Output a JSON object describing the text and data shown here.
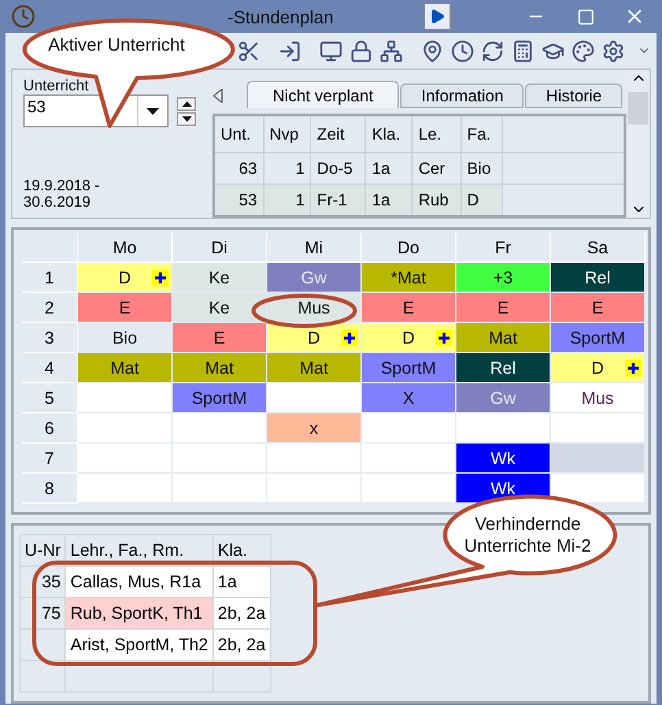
{
  "window": {
    "title": "-Stundenplan"
  },
  "lesson_panel": {
    "label": "Unterricht",
    "value": "53",
    "date_range": "19.9.2018 -\n30.6.2019"
  },
  "tabs": [
    {
      "label": "Nicht verplant",
      "selected": true
    },
    {
      "label": "Information",
      "selected": false
    },
    {
      "label": "Historie",
      "selected": false
    }
  ],
  "unplanned_table": {
    "columns": [
      "Unt.",
      "Nvp",
      "Zeit",
      "Kla.",
      "Le.",
      "Fa."
    ],
    "rows": [
      {
        "cells": [
          "63",
          "1",
          "Do-5",
          "1a",
          "Cer",
          "Bio"
        ],
        "selected": false
      },
      {
        "cells": [
          "53",
          "1",
          "Fr-1",
          "1a",
          "Rub",
          "D"
        ],
        "selected": true
      }
    ]
  },
  "timetable": {
    "days": [
      "Mo",
      "Di",
      "Mi",
      "Do",
      "Fr",
      "Sa"
    ],
    "periods": [
      {
        "label": "1",
        "cells": [
          {
            "text": "D",
            "color": "#ffff80",
            "flag": true
          },
          {
            "text": "Ke",
            "color": "#dce6e4"
          },
          {
            "text": "Gw",
            "color": "#8080c0"
          },
          {
            "text": "*Mat",
            "color": "#b8b800"
          },
          {
            "text": "+3",
            "color": "#40ff40"
          },
          {
            "text": "Rel",
            "color": "#004040"
          }
        ]
      },
      {
        "label": "2",
        "cells": [
          {
            "text": "E",
            "color": "#ff8080"
          },
          {
            "text": "Ke",
            "color": "#dce6e4"
          },
          {
            "text": "Mus",
            "color": "#dce6e4"
          },
          {
            "text": "E",
            "color": "#ff8080"
          },
          {
            "text": "E",
            "color": "#ff8080"
          },
          {
            "text": "E",
            "color": "#ff8080"
          }
        ]
      },
      {
        "label": "3",
        "cells": [
          {
            "text": "Bio",
            "color": "#e4eaf2"
          },
          {
            "text": "E",
            "color": "#ff8080"
          },
          {
            "text": "D",
            "color": "#ffff80",
            "flag": true
          },
          {
            "text": "D",
            "color": "#ffff80",
            "flag": true
          },
          {
            "text": "Mat",
            "color": "#b8b800"
          },
          {
            "text": "SportM",
            "color": "#8080ff"
          }
        ]
      },
      {
        "label": "4",
        "cells": [
          {
            "text": "Mat",
            "color": "#b8b800"
          },
          {
            "text": "Mat",
            "color": "#b8b800"
          },
          {
            "text": "Mat",
            "color": "#b8b800"
          },
          {
            "text": "SportM",
            "color": "#8080ff"
          },
          {
            "text": "Rel",
            "color": "#004040"
          },
          {
            "text": "D",
            "color": "#ffff80",
            "flag": true
          }
        ]
      },
      {
        "label": "5",
        "cells": [
          {
            "color": "#ffffff"
          },
          {
            "text": "SportM",
            "color": "#8080ff"
          },
          {
            "color": "#ffffff"
          },
          {
            "text": "X",
            "color": "#8080ff"
          },
          {
            "text": "Gw",
            "color": "#8080c0"
          },
          {
            "text": "Mus",
            "color": "#ffffff"
          }
        ]
      },
      {
        "label": "6",
        "cells": [
          {
            "color": "#ffffff"
          },
          {
            "color": "#ffffff"
          },
          {
            "text": "x",
            "color": "#ffb898"
          },
          {
            "color": "#ffffff"
          },
          {
            "color": "#ffffff"
          },
          {
            "color": "#ffffff"
          }
        ]
      },
      {
        "label": "7",
        "cells": [
          {
            "color": "#ffffff"
          },
          {
            "color": "#ffffff"
          },
          {
            "color": "#ffffff"
          },
          {
            "color": "#ffffff"
          },
          {
            "text": "Wk",
            "color": "#0000ff"
          },
          {
            "color": "#d2d9e4"
          }
        ]
      },
      {
        "label": "8",
        "cells": [
          {
            "color": "#ffffff"
          },
          {
            "color": "#ffffff"
          },
          {
            "color": "#ffffff"
          },
          {
            "color": "#ffffff"
          },
          {
            "text": "Wk",
            "color": "#0000ff"
          },
          {
            "color": "#ffffff"
          }
        ]
      }
    ]
  },
  "conflicts_table": {
    "columns": [
      "U-Nr",
      "Lehr., Fa., Rm.",
      "Kla."
    ],
    "rows": [
      {
        "cells": [
          "35",
          "Callas, Mus, R1a",
          "1a"
        ],
        "highlighted": false
      },
      {
        "cells": [
          "75",
          "Rub, SportK, Th1",
          "2b, 2a"
        ],
        "highlighted": true
      },
      {
        "cells": [
          "",
          "Arist, SportM, Th2",
          "2b, 2a"
        ],
        "highlighted": false
      }
    ]
  },
  "callouts": [
    {
      "text": "Aktiver Unterricht"
    },
    {
      "text": "Verhindernde Unterrichte Mi-2"
    }
  ]
}
